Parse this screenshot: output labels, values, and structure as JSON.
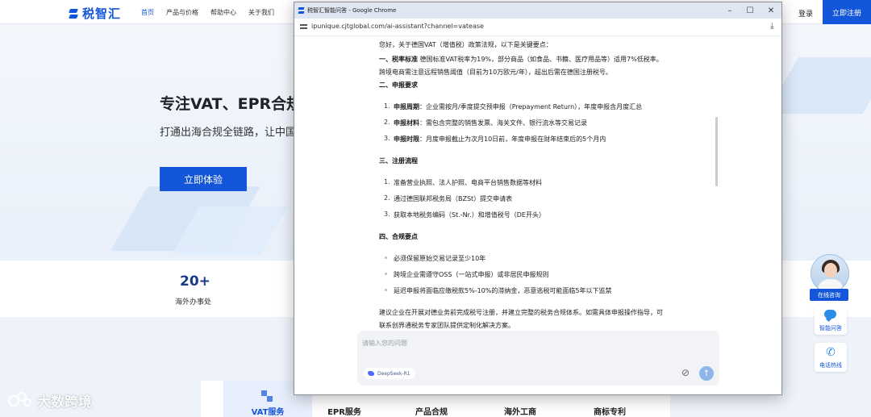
{
  "site": {
    "logo": "税智汇",
    "nav": [
      "首页",
      "产品与价格",
      "帮助中心",
      "关于我们"
    ],
    "login": "登录",
    "register": "立即注册",
    "hero_title": "专注VAT、EPR合规",
    "hero_subtitle": "打通出海合规全链路，让中国",
    "hero_cta": "立即体验",
    "stat_value": "20+",
    "stat_label": "海外办事处",
    "tabs": [
      "VAT服务",
      "EPR服务",
      "产品合规",
      "海外工商",
      "商标专利"
    ],
    "watermark": "大数跨境"
  },
  "side": {
    "online": "在线咨询",
    "ai": "智能问答",
    "hotline": "电话热线"
  },
  "popup": {
    "title": "税智汇智能问答 - Google Chrome",
    "url": "ipunique.cjtglobal.com/ai-assistant?channel=vatease",
    "intro": "您好，关于德国VAT（增值税）政策法规，以下是关键要点：",
    "s1_heading": "一、税率标准",
    "s1_text": "德国标准VAT税率为19%，部分商品（如食品、书籍、医疗用品等）适用7%低税率。",
    "s1_text2": "跨境电商需注意远程销售阈值（目前为10万欧元/年），超出后需在德国注册税号。",
    "s2_heading": "二、申报要求",
    "s2_items": [
      {
        "n": "1.",
        "bold": "申报周期",
        "text": "：企业需按月/季度提交预申报（Prepayment Return），年度申报含月度汇总"
      },
      {
        "n": "2.",
        "bold": "申报材料",
        "text": "：需包含完整的销售发票、海关文件、银行流水等交易记录"
      },
      {
        "n": "3.",
        "bold": "申报时限",
        "text": "：月度申报截止为次月10日前，年度申报在财年结束后的5个月内"
      }
    ],
    "s3_heading": "三、注册流程",
    "s3_items": [
      {
        "n": "1.",
        "text": "准备营业执照、法人护照、电商平台销售数据等材料"
      },
      {
        "n": "2.",
        "text": "通过德国联邦税务局（BZSt）提交申请表"
      },
      {
        "n": "3.",
        "text": "获取本地税务编码（St.-Nr.）和增值税号（DE开头）"
      }
    ],
    "s4_heading": "四、合规要点",
    "s4_items": [
      "必须保留原始交易记录至少10年",
      "跨境企业需遵守OSS（一站式申报）或非居民申报规则",
      "延迟申报将面临应缴税款5%-10%的滞纳金，恶意逃税可能面临5年以下监禁"
    ],
    "outro1": "建议企业在开展对德业务前完成税号注册，并建立完整的税务合规体系。如需具体申报操作指导，可",
    "outro2": "联系创界通税务专家团队提供定制化解决方案。",
    "input_placeholder": "请输入您的问题",
    "model": "DeepSeek-R1"
  },
  "colors": {
    "brand": "#1456d9",
    "accent": "#2a8de8"
  }
}
